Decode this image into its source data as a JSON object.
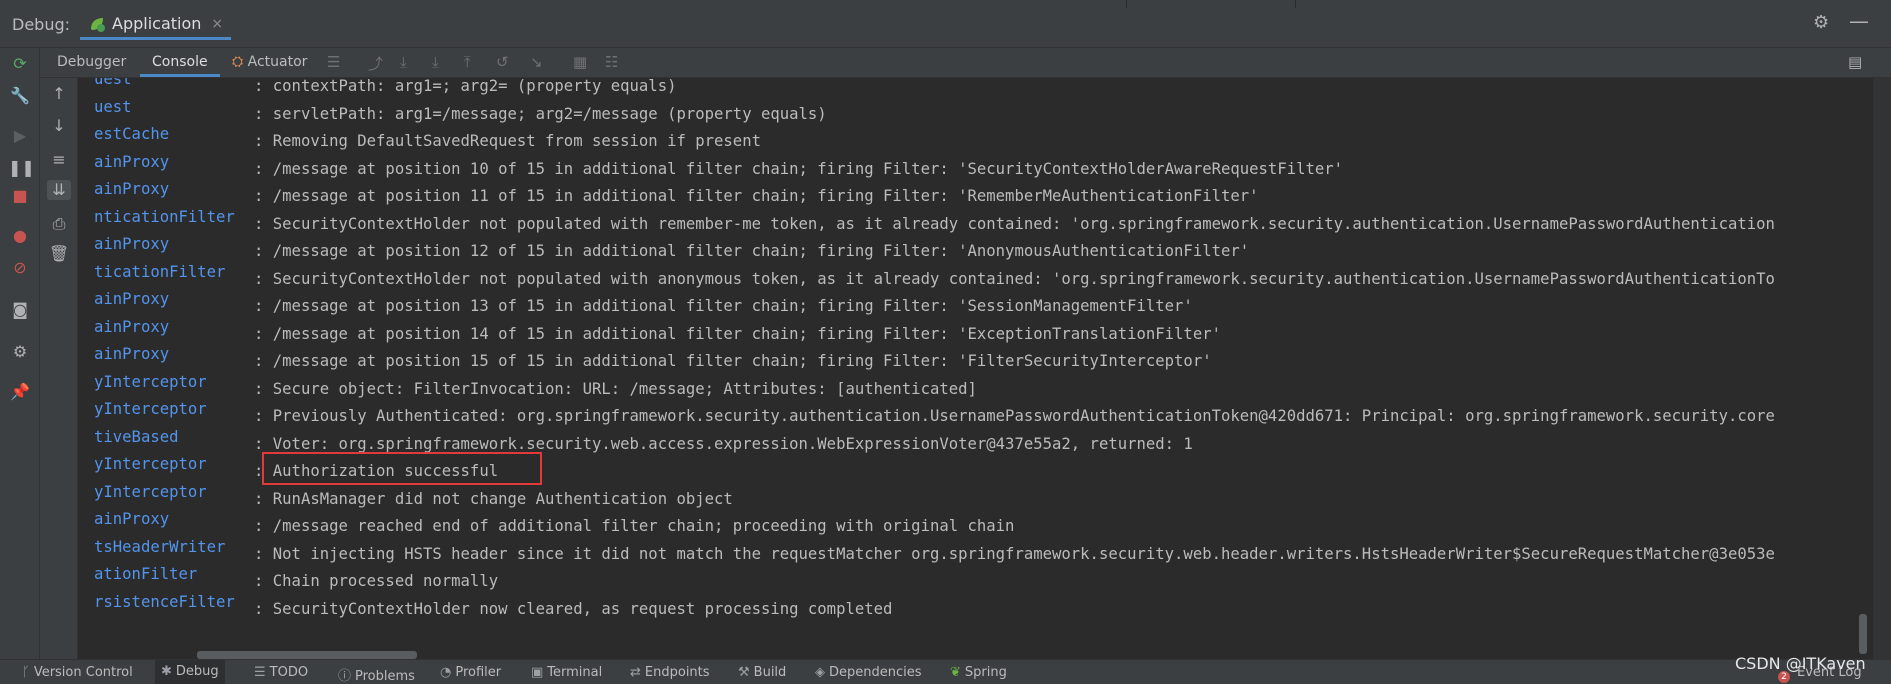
{
  "window": {
    "debug_label": "Debug:",
    "tab_title": "Application",
    "close_glyph": "×"
  },
  "toolbar": {
    "tabs": [
      "Debugger",
      "Console",
      "Actuator"
    ]
  },
  "console": {
    "lines": [
      {
        "src": "uest",
        "msg": ": contextPath: arg1=; arg2= (property equals)"
      },
      {
        "src": "uest",
        "msg": ": servletPath: arg1=/message; arg2=/message (property equals)"
      },
      {
        "src": "estCache",
        "msg": ": Removing DefaultSavedRequest from session if present"
      },
      {
        "src": "ainProxy",
        "msg": ": /message at position 10 of 15 in additional filter chain; firing Filter: 'SecurityContextHolderAwareRequestFilter'"
      },
      {
        "src": "ainProxy",
        "msg": ": /message at position 11 of 15 in additional filter chain; firing Filter: 'RememberMeAuthenticationFilter'"
      },
      {
        "src": "nticationFilter",
        "msg": ": SecurityContextHolder not populated with remember-me token, as it already contained: 'org.springframework.security.authentication.UsernamePasswordAuthentication"
      },
      {
        "src": "ainProxy",
        "msg": ": /message at position 12 of 15 in additional filter chain; firing Filter: 'AnonymousAuthenticationFilter'"
      },
      {
        "src": "ticationFilter",
        "msg": ": SecurityContextHolder not populated with anonymous token, as it already contained: 'org.springframework.security.authentication.UsernamePasswordAuthenticationTo"
      },
      {
        "src": "ainProxy",
        "msg": ": /message at position 13 of 15 in additional filter chain; firing Filter: 'SessionManagementFilter'"
      },
      {
        "src": "ainProxy",
        "msg": ": /message at position 14 of 15 in additional filter chain; firing Filter: 'ExceptionTranslationFilter'"
      },
      {
        "src": "ainProxy",
        "msg": ": /message at position 15 of 15 in additional filter chain; firing Filter: 'FilterSecurityInterceptor'"
      },
      {
        "src": "yInterceptor",
        "msg": ": Secure object: FilterInvocation: URL: /message; Attributes: [authenticated]"
      },
      {
        "src": "yInterceptor",
        "msg": ": Previously Authenticated: org.springframework.security.authentication.UsernamePasswordAuthenticationToken@420dd671: Principal: org.springframework.security.core"
      },
      {
        "src": "tiveBased",
        "msg": ": Voter: org.springframework.security.web.access.expression.WebExpressionVoter@437e55a2, returned: 1"
      },
      {
        "src": "yInterceptor",
        "msg": ": Authorization successful"
      },
      {
        "src": "yInterceptor",
        "msg": ": RunAsManager did not change Authentication object"
      },
      {
        "src": "ainProxy",
        "msg": ": /message reached end of additional filter chain; proceeding with original chain"
      },
      {
        "src": "tsHeaderWriter",
        "msg": ": Not injecting HSTS header since it did not match the requestMatcher org.springframework.security.web.header.writers.HstsHeaderWriter$SecureRequestMatcher@3e053e"
      },
      {
        "src": "ationFilter",
        "msg": ": Chain processed normally"
      },
      {
        "src": "rsistenceFilter",
        "msg": ": SecurityContextHolder now cleared, as request processing completed"
      }
    ]
  },
  "statusbar": {
    "items": [
      "Version Control",
      "Debug",
      "TODO",
      "Problems",
      "Profiler",
      "Terminal",
      "Endpoints",
      "Build",
      "Dependencies",
      "Spring",
      "Event Log"
    ],
    "event_count": "2",
    "watermark": "CSDN @ITKaven"
  },
  "colors": {
    "accent": "#4a88c7",
    "log_source": "#5394ec",
    "highlight": "#e03a3a"
  }
}
